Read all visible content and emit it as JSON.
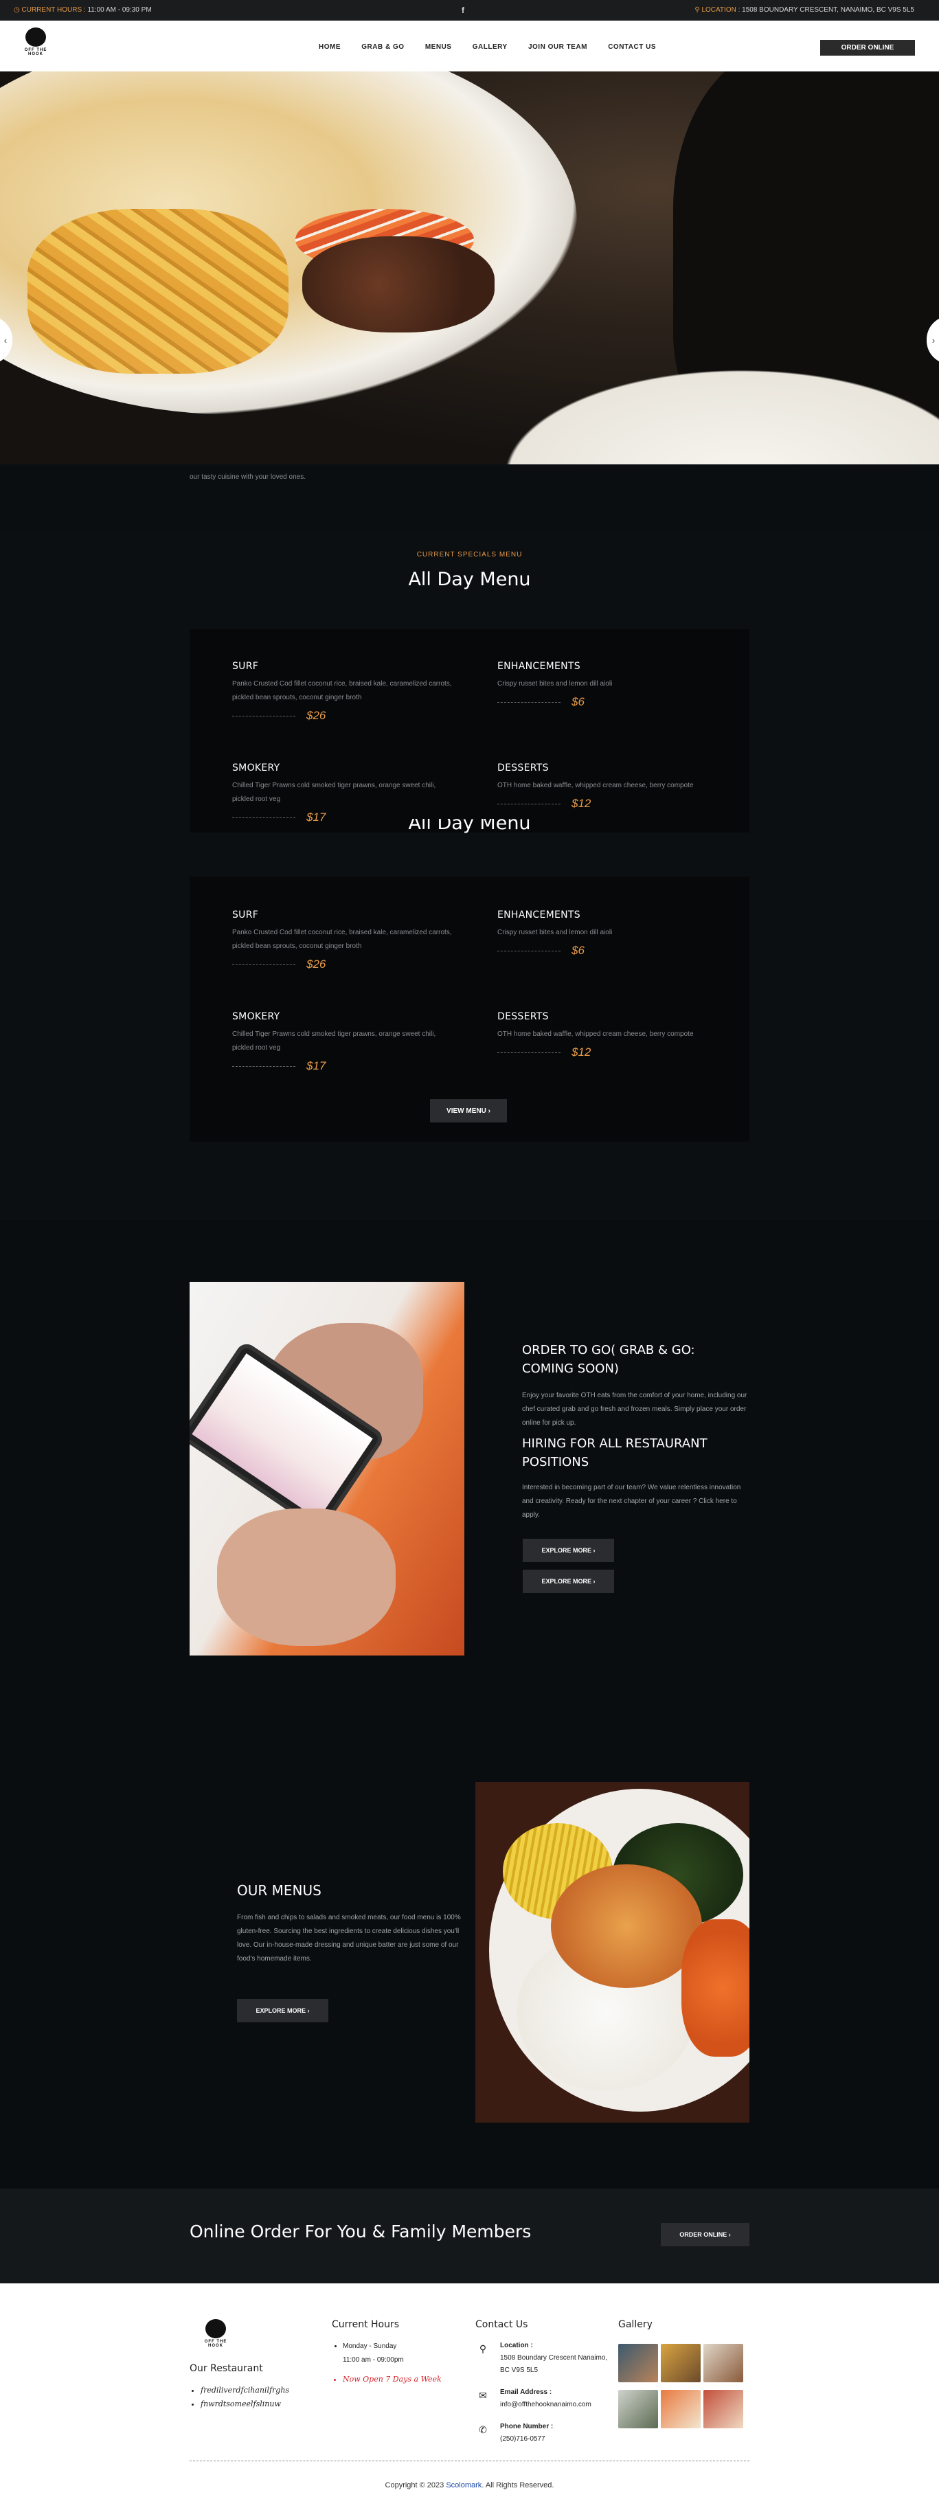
{
  "topbar": {
    "hours_label": "CURRENT HOURS :",
    "hours_value": "11:00 AM - 09:30 PM",
    "social_icon": "facebook-icon",
    "social_glyph": "f",
    "location_label": "LOCATION :",
    "location_value": "1508 BOUNDARY CRESCENT, NANAIMO, BC V9S 5L5"
  },
  "header": {
    "logo_text": "OFF THE HOOK",
    "nav": [
      "HOME",
      "GRAB & GO",
      "MENUS",
      "GALLERY",
      "JOIN OUR TEAM",
      "CONTACT US"
    ],
    "order_button": "ORDER ONLINE"
  },
  "hero": {
    "prev_glyph": "‹",
    "next_glyph": "›",
    "caption_text": "our tasty cuisine with your loved ones."
  },
  "all_day_menu": {
    "eyebrow": "CURRENT SPECIALS MENU",
    "title": "All Day Menu",
    "overlap_title": "All Day Menu",
    "items": [
      {
        "name": "SURF",
        "desc": "Panko Crusted Cod fillet coconut rice, braised kale, caramelized carrots, pickled bean sprouts, coconut ginger broth",
        "price": "$26"
      },
      {
        "name": "ENHANCEMENTS",
        "desc": "Crispy russet bites and lemon dill aioli",
        "price": "$6"
      },
      {
        "name": "SMOKERY",
        "desc": "Chilled Tiger Prawns cold smoked tiger prawns, orange sweet chili, pickled root veg",
        "price": "$17"
      },
      {
        "name": "DESSERTS",
        "desc": "OTH home baked waffle, whipped cream cheese, berry compote",
        "price": "$12"
      }
    ],
    "view_menu_button": "VIEW MENU",
    "arrow_glyph": "›"
  },
  "order_section": {
    "heading1": "ORDER TO GO( GRAB & GO: COMING SOON)",
    "text1": "Enjoy your favorite OTH eats from the comfort of your home, including our chef curated grab and go fresh and frozen meals. Simply place your order online for pick up.",
    "heading2": "HIRING FOR ALL RESTAURANT POSITIONS",
    "text2": "Interested in becoming part of our team? We value relentless innovation and creativity. Ready for the next chapter of your career ? Click here to apply.",
    "button1": "EXPLORE MORE",
    "button2": "EXPLORE MORE"
  },
  "our_menus": {
    "heading": "OUR MENUS",
    "text": "From fish and chips to salads and smoked meats, our food menu is 100% gluten-free. Sourcing the best ingredients to create delicious dishes you'll love. Our in-house-made dressing and unique batter are just some of our food's homemade items.",
    "button": "EXPLORE MORE"
  },
  "cta": {
    "heading": "Online Order For You & Family Members",
    "button": "ORDER ONLINE"
  },
  "footer": {
    "logo_text": "OFF THE HOOK",
    "restaurant_heading": "Our Restaurant",
    "restaurant_links": [
      "frediliverdfcihanilfrghs",
      "fnwrdtsomeelfslinuw"
    ],
    "hours_heading": "Current Hours",
    "hours_days": "Monday - Sunday",
    "hours_time": "11:00 am - 09:00pm",
    "hours_note": "Now Open 7 Days a Week",
    "contact_heading": "Contact Us",
    "location_label": "Location :",
    "location_value": "1508 Boundary Crescent Nanaimo, BC V9S 5L5",
    "email_label": "Email Address :",
    "email_value": "info@offthehooknanaimo.com",
    "phone_label": "Phone Number :",
    "phone_value": "(250)716-0577",
    "gallery_heading": "Gallery",
    "copyright_prefix": "Copyright © 2023",
    "copyright_brand": "Scolomark",
    "copyright_suffix": ". All Rights Reserved."
  },
  "colors": {
    "accent": "#e79a48",
    "dark_bg": "#0b0e11",
    "card_bg": "#070809",
    "button_bg": "#2a2c2f",
    "note_red": "#d4232a",
    "link_blue": "#1a47a6"
  }
}
